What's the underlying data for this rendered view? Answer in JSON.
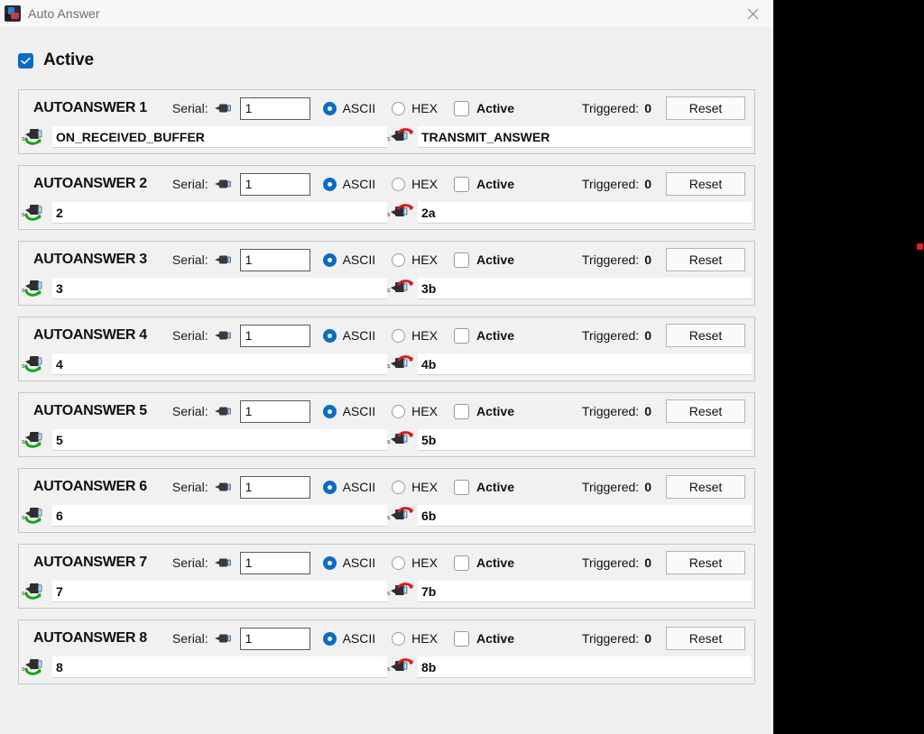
{
  "window": {
    "title": "Auto Answer",
    "close_label": "✕",
    "app_icon": "auto-answer-app-icon"
  },
  "global": {
    "active_label": "Active",
    "active_checked": true,
    "checkbox_color": "#0a6cc4"
  },
  "labels": {
    "serial": "Serial:",
    "ascii": "ASCII",
    "hex": "HEX",
    "active": "Active",
    "triggered": "Triggered:",
    "reset": "Reset",
    "serial_icon": "serial-port-icon",
    "receive_icon": "serial-receive-icon",
    "transmit_icon": "serial-transmit-icon"
  },
  "rows": [
    {
      "title": "AUTOANSWER 1",
      "serial": "1",
      "format": "ASCII",
      "ascii_selected": true,
      "hex_selected": false,
      "active_checked": false,
      "triggered": "0",
      "received": "ON_RECEIVED_BUFFER",
      "transmit": "TRANSMIT_ANSWER"
    },
    {
      "title": "AUTOANSWER 2",
      "serial": "1",
      "format": "ASCII",
      "ascii_selected": true,
      "hex_selected": false,
      "active_checked": false,
      "triggered": "0",
      "received": "2",
      "transmit": "2a"
    },
    {
      "title": "AUTOANSWER 3",
      "serial": "1",
      "format": "ASCII",
      "ascii_selected": true,
      "hex_selected": false,
      "active_checked": false,
      "triggered": "0",
      "received": "3",
      "transmit": "3b"
    },
    {
      "title": "AUTOANSWER 4",
      "serial": "1",
      "format": "ASCII",
      "ascii_selected": true,
      "hex_selected": false,
      "active_checked": false,
      "triggered": "0",
      "received": "4",
      "transmit": "4b"
    },
    {
      "title": "AUTOANSWER 5",
      "serial": "1",
      "format": "ASCII",
      "ascii_selected": true,
      "hex_selected": false,
      "active_checked": false,
      "triggered": "0",
      "received": "5",
      "transmit": "5b"
    },
    {
      "title": "AUTOANSWER 6",
      "serial": "1",
      "format": "ASCII",
      "ascii_selected": true,
      "hex_selected": false,
      "active_checked": false,
      "triggered": "0",
      "received": "6",
      "transmit": "6b"
    },
    {
      "title": "AUTOANSWER 7",
      "serial": "1",
      "format": "ASCII",
      "ascii_selected": true,
      "hex_selected": false,
      "active_checked": false,
      "triggered": "0",
      "received": "7",
      "transmit": "7b"
    },
    {
      "title": "AUTOANSWER 8",
      "serial": "1",
      "format": "ASCII",
      "ascii_selected": true,
      "hex_selected": false,
      "active_checked": false,
      "triggered": "0",
      "received": "8",
      "transmit": "8b"
    }
  ],
  "cursor": {
    "name": "cursor-marker",
    "color": "#e02020"
  }
}
